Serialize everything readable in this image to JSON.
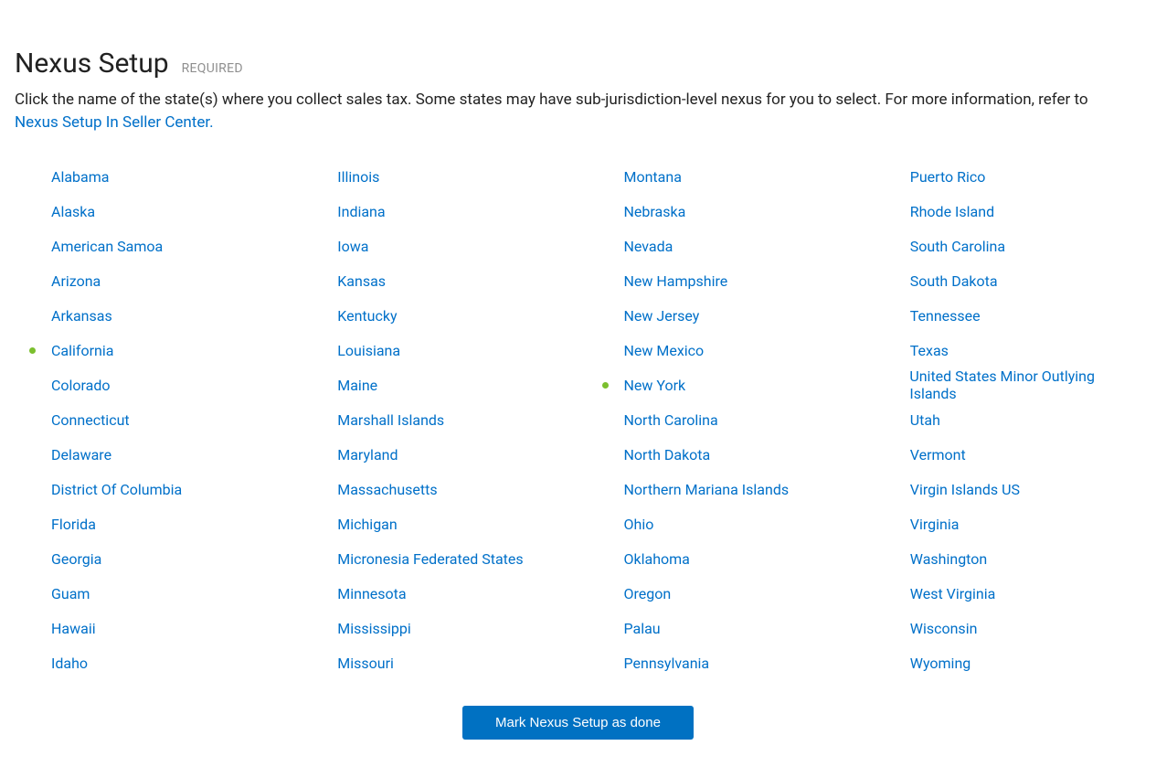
{
  "header": {
    "title": "Nexus Setup",
    "required_label": "REQUIRED"
  },
  "description": {
    "text_before_link": "Click the name of the state(s) where you collect sales tax. Some states may have sub-jurisdiction-level nexus for you to select. For more information, refer to ",
    "link_text": "Nexus Setup In Seller Center."
  },
  "columns": [
    [
      {
        "name": "Alabama",
        "selected": false
      },
      {
        "name": "Alaska",
        "selected": false
      },
      {
        "name": "American Samoa",
        "selected": false
      },
      {
        "name": "Arizona",
        "selected": false
      },
      {
        "name": "Arkansas",
        "selected": false
      },
      {
        "name": "California",
        "selected": true
      },
      {
        "name": "Colorado",
        "selected": false
      },
      {
        "name": "Connecticut",
        "selected": false
      },
      {
        "name": "Delaware",
        "selected": false
      },
      {
        "name": "District Of Columbia",
        "selected": false
      },
      {
        "name": "Florida",
        "selected": false
      },
      {
        "name": "Georgia",
        "selected": false
      },
      {
        "name": "Guam",
        "selected": false
      },
      {
        "name": "Hawaii",
        "selected": false
      },
      {
        "name": "Idaho",
        "selected": false
      }
    ],
    [
      {
        "name": "Illinois",
        "selected": false
      },
      {
        "name": "Indiana",
        "selected": false
      },
      {
        "name": "Iowa",
        "selected": false
      },
      {
        "name": "Kansas",
        "selected": false
      },
      {
        "name": "Kentucky",
        "selected": false
      },
      {
        "name": "Louisiana",
        "selected": false
      },
      {
        "name": "Maine",
        "selected": false
      },
      {
        "name": "Marshall Islands",
        "selected": false
      },
      {
        "name": "Maryland",
        "selected": false
      },
      {
        "name": "Massachusetts",
        "selected": false
      },
      {
        "name": "Michigan",
        "selected": false
      },
      {
        "name": "Micronesia Federated States",
        "selected": false
      },
      {
        "name": "Minnesota",
        "selected": false
      },
      {
        "name": "Mississippi",
        "selected": false
      },
      {
        "name": "Missouri",
        "selected": false
      }
    ],
    [
      {
        "name": "Montana",
        "selected": false
      },
      {
        "name": "Nebraska",
        "selected": false
      },
      {
        "name": "Nevada",
        "selected": false
      },
      {
        "name": "New Hampshire",
        "selected": false
      },
      {
        "name": "New Jersey",
        "selected": false
      },
      {
        "name": "New Mexico",
        "selected": false
      },
      {
        "name": "New York",
        "selected": true
      },
      {
        "name": "North Carolina",
        "selected": false
      },
      {
        "name": "North Dakota",
        "selected": false
      },
      {
        "name": "Northern Mariana Islands",
        "selected": false
      },
      {
        "name": "Ohio",
        "selected": false
      },
      {
        "name": "Oklahoma",
        "selected": false
      },
      {
        "name": "Oregon",
        "selected": false
      },
      {
        "name": "Palau",
        "selected": false
      },
      {
        "name": "Pennsylvania",
        "selected": false
      }
    ],
    [
      {
        "name": "Puerto Rico",
        "selected": false
      },
      {
        "name": "Rhode Island",
        "selected": false
      },
      {
        "name": "South Carolina",
        "selected": false
      },
      {
        "name": "South Dakota",
        "selected": false
      },
      {
        "name": "Tennessee",
        "selected": false
      },
      {
        "name": "Texas",
        "selected": false
      },
      {
        "name": "United States Minor Outlying Islands",
        "selected": false
      },
      {
        "name": "Utah",
        "selected": false
      },
      {
        "name": "Vermont",
        "selected": false
      },
      {
        "name": "Virgin Islands US",
        "selected": false
      },
      {
        "name": "Virginia",
        "selected": false
      },
      {
        "name": "Washington",
        "selected": false
      },
      {
        "name": "West Virginia",
        "selected": false
      },
      {
        "name": "Wisconsin",
        "selected": false
      },
      {
        "name": "Wyoming",
        "selected": false
      }
    ]
  ],
  "footer": {
    "button_label": "Mark Nexus Setup as done"
  }
}
